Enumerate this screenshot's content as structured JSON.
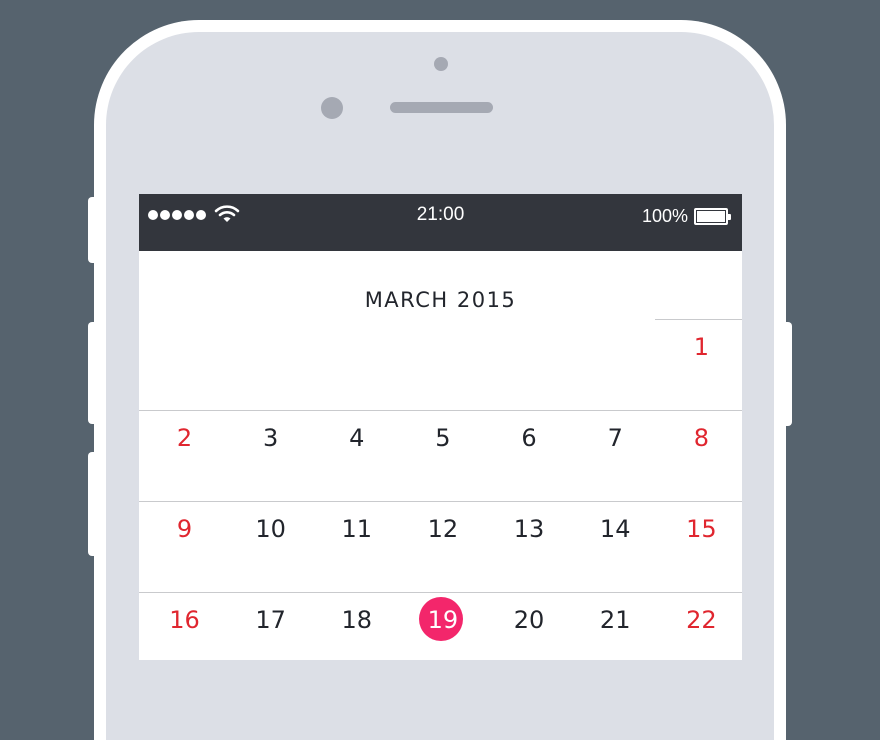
{
  "status_bar": {
    "time": "21:00",
    "battery": "100%",
    "signal_icon": "signal-dots-icon",
    "wifi_icon": "wifi-icon",
    "battery_icon": "battery-icon"
  },
  "calendar": {
    "month_title": "MARCH 2015",
    "weeks": [
      [
        "",
        "",
        "",
        "",
        "",
        "",
        "1"
      ],
      [
        "2",
        "3",
        "4",
        "5",
        "6",
        "7",
        "8"
      ],
      [
        "9",
        "10",
        "11",
        "12",
        "13",
        "14",
        "15"
      ],
      [
        "16",
        "17",
        "18",
        "19",
        "20",
        "21",
        "22"
      ]
    ],
    "today": "19",
    "colors": {
      "weekend": "#e0262f",
      "today": "#f3266b",
      "status_bar": "#33363d",
      "background": "#56636e"
    }
  }
}
